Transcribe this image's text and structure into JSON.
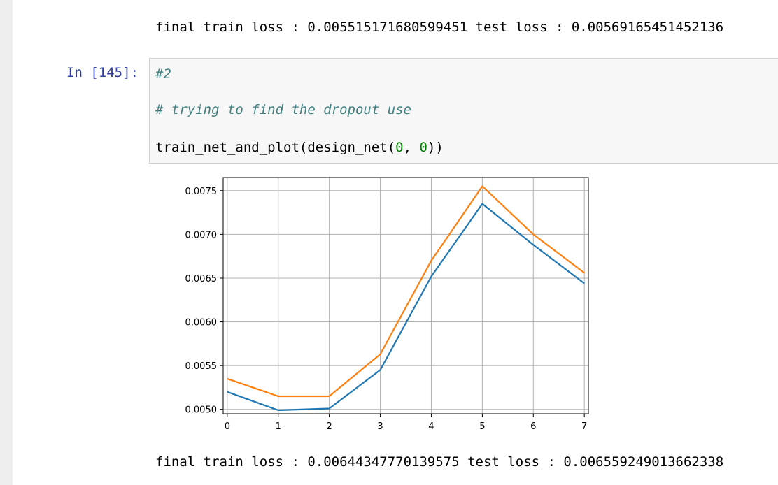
{
  "outputs": {
    "top": "final train loss : 0.005515171680599451 test loss : 0.00569165451452136",
    "bottom": "final train loss : 0.00644347770139575 test loss : 0.006559249013662338"
  },
  "cell": {
    "prompt": "In [145]:",
    "code": {
      "line1": "#2",
      "line2": "# trying to find the dropout use",
      "line3_func": "train_net_and_plot(design_net(",
      "line3_arg1": "0",
      "line3_sep": ", ",
      "line3_arg2": "0",
      "line3_end": "))"
    }
  },
  "chart_data": {
    "type": "line",
    "x": [
      0,
      1,
      2,
      3,
      4,
      5,
      6,
      7
    ],
    "xticks": [
      "0",
      "1",
      "2",
      "3",
      "4",
      "5",
      "6",
      "7"
    ],
    "yticks": [
      "0.0050",
      "0.0055",
      "0.0060",
      "0.0065",
      "0.0070",
      "0.0075"
    ],
    "ytick_values": [
      0.005,
      0.0055,
      0.006,
      0.0065,
      0.007,
      0.0075
    ],
    "xlim": [
      -0.08,
      7.08
    ],
    "ylim": [
      0.00495,
      0.00765
    ],
    "grid": true,
    "series": [
      {
        "color": "#1f77b4",
        "values": [
          0.0052,
          0.00499,
          0.00501,
          0.00545,
          0.00652,
          0.00735,
          0.00688,
          0.00644
        ]
      },
      {
        "color": "#ff7f0e",
        "values": [
          0.00535,
          0.00515,
          0.00515,
          0.00563,
          0.0067,
          0.00755,
          0.007,
          0.00656
        ]
      }
    ]
  }
}
